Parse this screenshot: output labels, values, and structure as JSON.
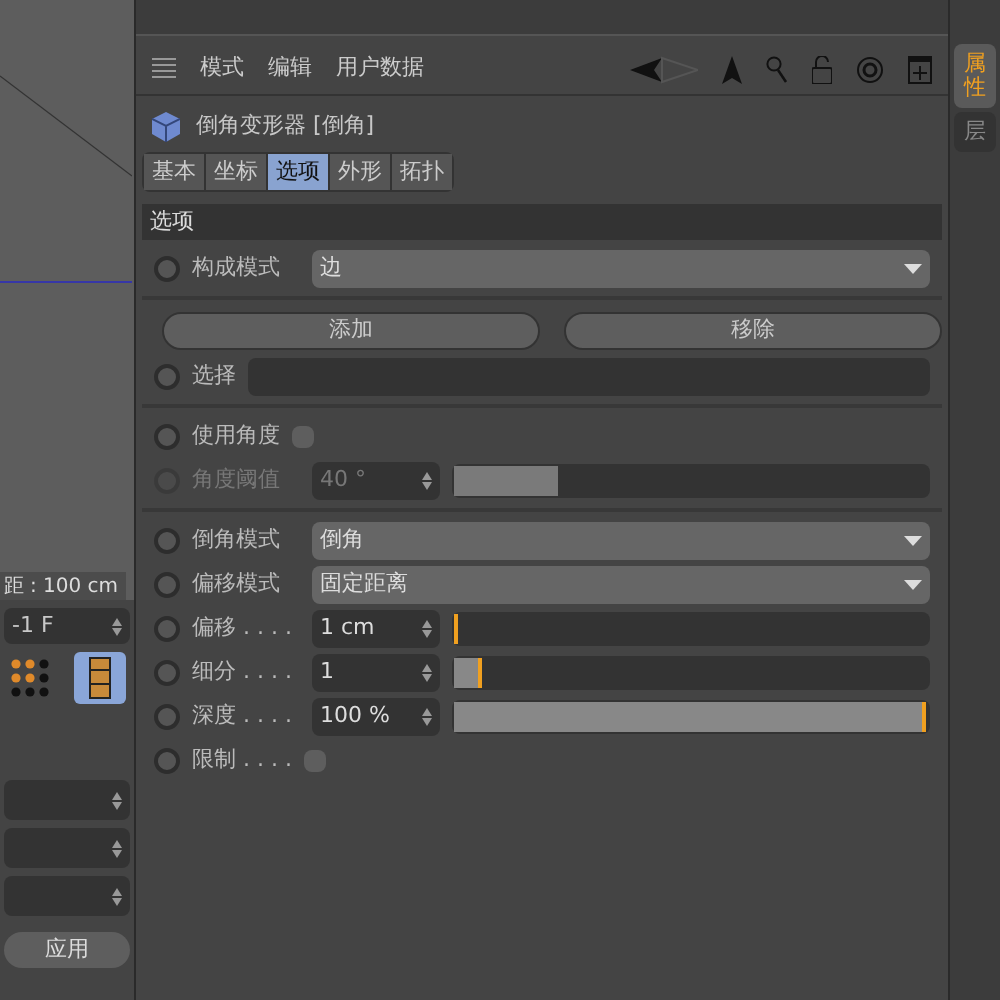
{
  "viewport": {
    "readout": "距 : 100 cm"
  },
  "left_panel": {
    "frame_field": "-1 F",
    "apply_button": "应用"
  },
  "menu": [
    "模式",
    "编辑",
    "用户数据"
  ],
  "object": {
    "title": "倒角变形器 [倒角]"
  },
  "tabs": [
    {
      "label": "基本",
      "selected": false
    },
    {
      "label": "坐标",
      "selected": false
    },
    {
      "label": "选项",
      "selected": true
    },
    {
      "label": "外形",
      "selected": false
    },
    {
      "label": "拓扑",
      "selected": false
    }
  ],
  "section": "选项",
  "groups": [
    [
      {
        "kind": "dropdown",
        "label": "构成模式",
        "value": "边"
      }
    ],
    [
      {
        "kind": "buttons",
        "buttons": [
          "添加",
          "移除"
        ]
      },
      {
        "kind": "link",
        "label": "选择"
      }
    ],
    [
      {
        "kind": "checkbox",
        "label": "使用角度",
        "checked": false
      },
      {
        "kind": "slider",
        "label": "角度阈值",
        "value": "40 °",
        "level": 0.22,
        "disabled": true
      }
    ],
    [
      {
        "kind": "dropdown",
        "label": "倒角模式",
        "value": "倒角"
      },
      {
        "kind": "dropdown",
        "label": "偏移模式",
        "value": "固定距离"
      },
      {
        "kind": "slider",
        "label": "偏移 . . . .",
        "value": "1 cm",
        "level": 0.01,
        "disabled": false
      },
      {
        "kind": "slider",
        "label": "细分 . . . .",
        "value": "1",
        "level": 0.06,
        "disabled": false
      },
      {
        "kind": "slider",
        "label": "深度 . . . .",
        "value": "100 %",
        "level": 1,
        "disabled": false
      },
      {
        "kind": "checkbox",
        "label": "限制 . . . .",
        "checked": false
      }
    ]
  ],
  "side_tabs": [
    {
      "label": "属性",
      "selected": true
    },
    {
      "label": "层",
      "selected": false
    }
  ]
}
